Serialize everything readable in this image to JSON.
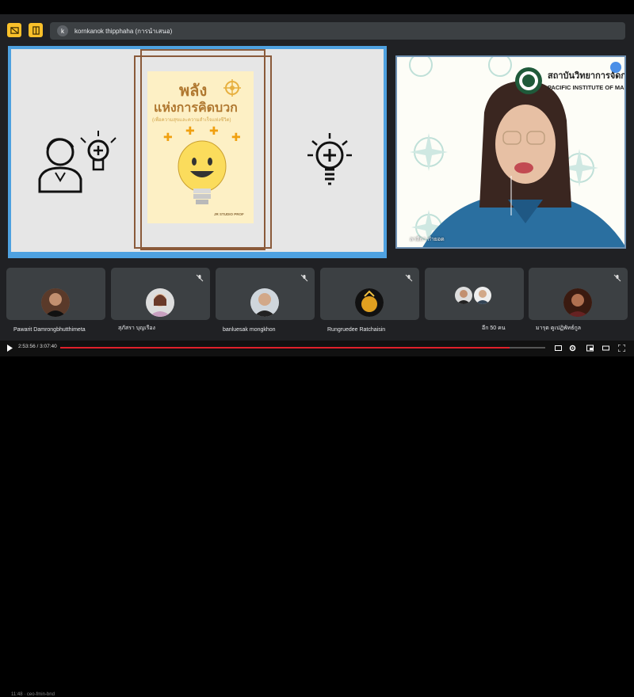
{
  "meeting": {
    "presenter_initial": "k",
    "presenter_label": "kornkanok thipphaha (การนำเสนอ)"
  },
  "slide": {
    "cover_title_line1": "พลัง",
    "cover_title_line2": "แห่งการคิดบวก",
    "cover_subtitle": "(เพื่อความสุขและความสำเร็จแห่งชีวิต)",
    "cover_brand": "JR STUDIO PROF"
  },
  "main_video": {
    "org_name_th": "สถาบันวิทยาการจัดการ",
    "org_name_en": "PACIFIC INSTITUTE OF MANA",
    "participant_name": "ลาลีกา กำยอด"
  },
  "participants": [
    {
      "name": "Pawarit Damrongbhutthimeta"
    },
    {
      "name": "สุภัสรา บุญเรือง"
    },
    {
      "name": "banluesak mongkhon"
    },
    {
      "name": "Rungruedee Ratchaisin"
    },
    {
      "name": "อีก 50 คน"
    },
    {
      "name": "มารุต ฅูเปฏิพัทธ์กูล"
    }
  ],
  "player": {
    "time_display": "2:53:56 / 3:07:40",
    "progress": 0.927,
    "overlay_text": "11:48 · ceo-fmin-bnd"
  },
  "colors": {
    "accent_yellow": "#f9c02a",
    "progress_red": "#e0202a",
    "tile_bg": "#3c4043"
  }
}
